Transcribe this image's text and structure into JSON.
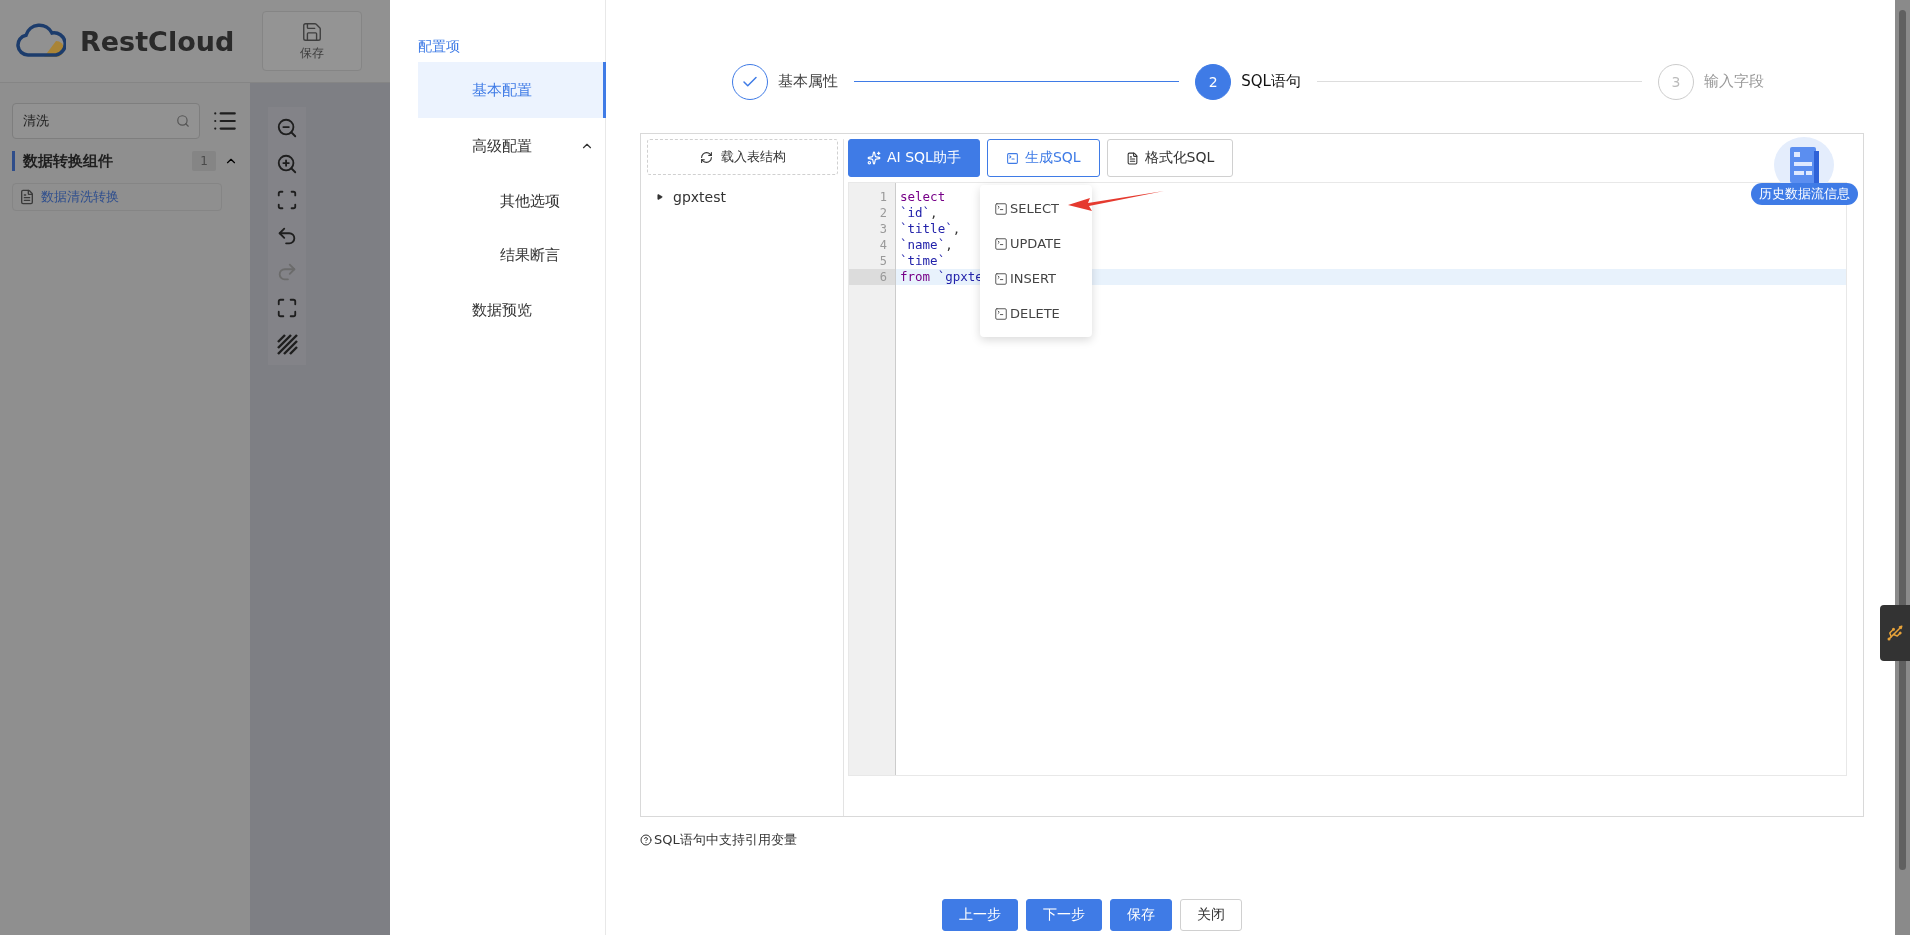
{
  "app": {
    "logo": "RestCloud",
    "toolbar": [
      {
        "label": "保存"
      }
    ]
  },
  "sidebar": {
    "search": {
      "value": "清洗"
    },
    "group": {
      "title": "数据转换组件",
      "count": "1",
      "expanded": true,
      "items": [
        {
          "label": "数据清洗转换"
        }
      ]
    }
  },
  "drawer": {
    "menu_title": "配置项",
    "menu": [
      {
        "label": "基本配置",
        "selected": true
      },
      {
        "label": "高级配置",
        "selected": false,
        "expanded": true,
        "children": [
          {
            "label": "其他选项",
            "selected": false
          },
          {
            "label": "结果断言",
            "selected": false
          }
        ]
      },
      {
        "label": "数据预览",
        "selected": false
      }
    ],
    "steps": [
      {
        "label": "基本属性",
        "finished": true,
        "selected": false
      },
      {
        "number": "2",
        "label": "SQL语句",
        "finished": false,
        "selected": true
      },
      {
        "number": "3",
        "label": "输入字段",
        "finished": false,
        "selected": false
      }
    ],
    "load_button": "载入表结构",
    "tree": [
      {
        "label": "gpxtest",
        "expanded": false
      }
    ],
    "toolbar": [
      {
        "label": "AI SQL助手",
        "kind": "primary"
      },
      {
        "label": "生成SQL",
        "kind": "open"
      },
      {
        "label": "格式化SQL",
        "kind": "default"
      }
    ],
    "code": [
      {
        "number": "1",
        "active": false,
        "tokens": [
          {
            "text": "select",
            "kind": "keyword"
          }
        ]
      },
      {
        "number": "2",
        "active": false,
        "tokens": [
          {
            "text": "`id`",
            "kind": "ident"
          },
          {
            "text": ",",
            "kind": "punct"
          }
        ]
      },
      {
        "number": "3",
        "active": false,
        "tokens": [
          {
            "text": "`title`",
            "kind": "ident"
          },
          {
            "text": ",",
            "kind": "punct"
          }
        ]
      },
      {
        "number": "4",
        "active": false,
        "tokens": [
          {
            "text": "`name`",
            "kind": "ident"
          },
          {
            "text": ",",
            "kind": "punct"
          }
        ]
      },
      {
        "number": "5",
        "active": false,
        "tokens": [
          {
            "text": "`time`",
            "kind": "ident"
          }
        ]
      },
      {
        "number": "6",
        "active": true,
        "tokens": [
          {
            "text": "from",
            "kind": "keyword"
          },
          {
            "text": "`gpxte",
            "kind": "ident"
          }
        ]
      }
    ],
    "dropdown": [
      "SELECT",
      "UPDATE",
      "INSERT",
      "DELETE"
    ],
    "history_button": "历史数据流信息",
    "hint": "SQL语句中支持引用变量",
    "buttons": [
      {
        "label": "上一步",
        "kind": "primary"
      },
      {
        "label": "下一步",
        "kind": "primary"
      },
      {
        "label": "保存",
        "kind": "primary"
      },
      {
        "label": "关闭",
        "kind": "default"
      }
    ]
  }
}
